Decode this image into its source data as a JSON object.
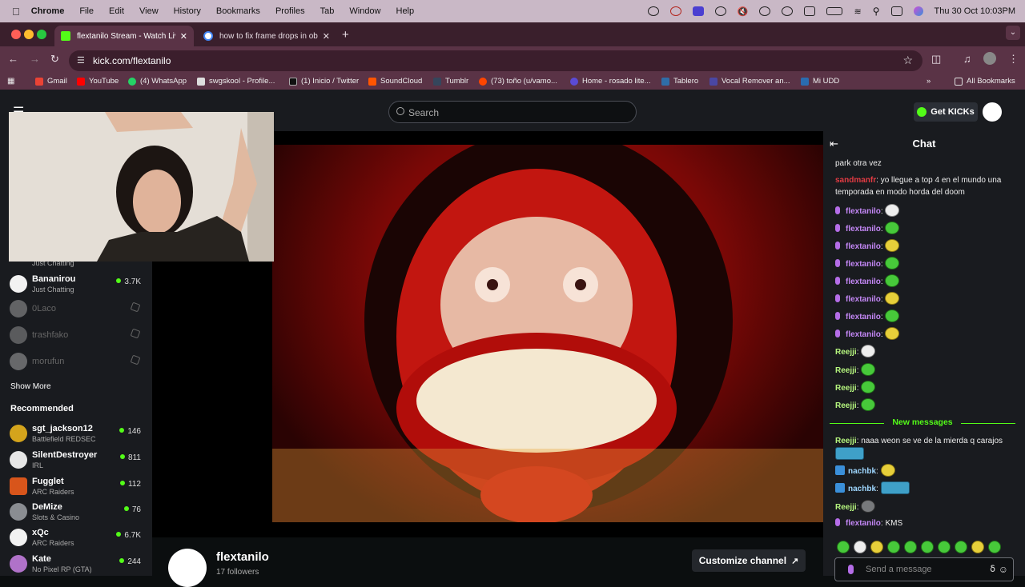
{
  "menubar": {
    "items": [
      "Chrome",
      "File",
      "Edit",
      "View",
      "History",
      "Bookmarks",
      "Profiles",
      "Tab",
      "Window",
      "Help"
    ],
    "datetime": "Thu 30 Oct  10:03PM"
  },
  "tabs": [
    {
      "title": "flextanilo Stream - Watch Live",
      "favicon_color": "#53fc18"
    },
    {
      "title": "how to fix frame drops in obs",
      "favicon_color": "#4285f4"
    }
  ],
  "toolbar": {
    "url": "kick.com/flextanilo"
  },
  "bookmarks": [
    {
      "label": "Gmail",
      "color": "#ea4335"
    },
    {
      "label": "YouTube",
      "color": "#ff0000"
    },
    {
      "label": "(4) WhatsApp",
      "color": "#25d366"
    },
    {
      "label": "swgskool - Profile...",
      "color": "#dddddd"
    },
    {
      "label": "(1) Inicio / Twitter",
      "color": "#111111"
    },
    {
      "label": "SoundCloud",
      "color": "#ff5500"
    },
    {
      "label": "Tumblr",
      "color": "#35465c"
    },
    {
      "label": "(73) toño (u/vamo...",
      "color": "#ff4500"
    },
    {
      "label": "Home - rosado lite...",
      "color": "#5b4bd6"
    },
    {
      "label": "Tablero",
      "color": "#2f6da8"
    },
    {
      "label": "Vocal Remover an...",
      "color": "#4a47a3"
    },
    {
      "label": "Mi UDD",
      "color": "#2a6cb0"
    }
  ],
  "all_bookmarks_label": "All Bookmarks",
  "kick": {
    "search_placeholder": "Search",
    "get_kicks_label": "Get KICKs"
  },
  "sidebar": {
    "followed": [
      {
        "name": "",
        "category": "Just Chatting",
        "viewers": ""
      },
      {
        "name": "Bananirou",
        "category": "Just Chatting",
        "viewers": "3.7K"
      },
      {
        "name": "0Laco",
        "offline": true
      },
      {
        "name": "trashfako",
        "offline": true
      },
      {
        "name": "morufun",
        "offline": true
      }
    ],
    "show_more_label": "Show More",
    "recommended_label": "Recommended",
    "recommended": [
      {
        "name": "sgt_jackson12",
        "category": "Battlefield REDSEC",
        "viewers": "146",
        "color": "#d4a41c"
      },
      {
        "name": "SilentDestroyer",
        "category": "IRL",
        "viewers": "811",
        "color": "#e6e6e6"
      },
      {
        "name": "Fugglet",
        "category": "ARC Raiders",
        "viewers": "112",
        "color": "#d8551b"
      },
      {
        "name": "DeMize",
        "category": "Slots & Casino",
        "viewers": "76",
        "color": "#8a8d92"
      },
      {
        "name": "xQc",
        "category": "ARC Raiders",
        "viewers": "6.7K",
        "color": "#f2f2f2"
      },
      {
        "name": "Kate",
        "category": "No Pixel RP (GTA)",
        "viewers": "244",
        "color": "#b072c9"
      }
    ]
  },
  "channel": {
    "name": "flextanilo",
    "followers": "17 followers",
    "customize_label": "Customize channel"
  },
  "chat": {
    "title": "Chat",
    "messages_before": [
      {
        "user": "",
        "text": "park otra vez",
        "color": "plain"
      },
      {
        "user": "sandmanfr",
        "text": "yo llegue a top 4 en el mundo una temporada en modo horda del doom",
        "color": "red"
      },
      {
        "user": "flextanilo",
        "emote": "w",
        "color": "purple",
        "mic": true
      },
      {
        "user": "flextanilo",
        "emote": "g",
        "color": "purple",
        "mic": true
      },
      {
        "user": "flextanilo",
        "emote": "y",
        "color": "purple",
        "mic": true
      },
      {
        "user": "flextanilo",
        "emote": "g",
        "color": "purple",
        "mic": true
      },
      {
        "user": "flextanilo",
        "emote": "g",
        "color": "purple",
        "mic": true
      },
      {
        "user": "flextanilo",
        "emote": "y",
        "color": "purple",
        "mic": true
      },
      {
        "user": "flextanilo",
        "emote": "g",
        "color": "purple",
        "mic": true
      },
      {
        "user": "flextanilo",
        "emote": "y",
        "color": "purple",
        "mic": true
      },
      {
        "user": "Reejji",
        "emote": "w",
        "color": "green"
      },
      {
        "user": "Reejji",
        "emote": "g",
        "color": "green"
      },
      {
        "user": "Reejji",
        "emote": "g",
        "color": "green"
      },
      {
        "user": "Reejji",
        "emote": "g",
        "color": "green"
      }
    ],
    "new_messages_label": "New messages",
    "reejji_msg": {
      "user": "Reejji",
      "text": "naaa weon se ve de la mierda q carajos"
    },
    "nachbk_1": {
      "user": "nachbk"
    },
    "nachbk_2": {
      "user": "nachbk"
    },
    "reejji_2": {
      "user": "Reejji"
    },
    "flex_kms": {
      "user": "flextanilo",
      "text": "KMS"
    },
    "input_placeholder": "Send a message"
  }
}
